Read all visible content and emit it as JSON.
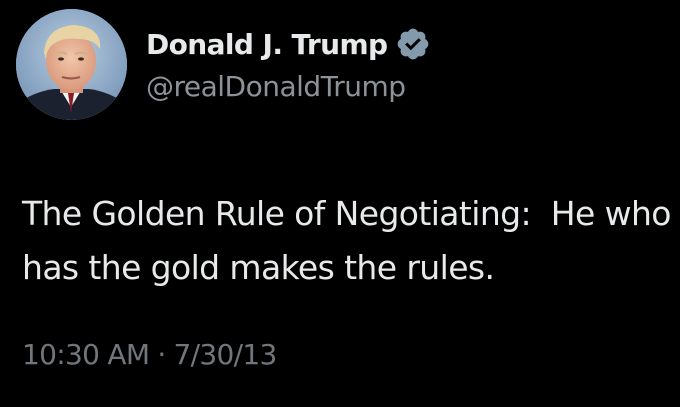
{
  "author": {
    "display_name": "Donald J. Trump",
    "handle": "@realDonaldTrump",
    "verified_icon": "verified-badge-icon",
    "avatar_icon": "profile-photo"
  },
  "tweet": {
    "text": "The Golden Rule of Negotiating:  He who has the gold makes the rules."
  },
  "meta": {
    "time": "10:30 AM",
    "separator": "·",
    "date": "7/30/13"
  },
  "colors": {
    "background": "#000000",
    "primary_text": "#e7e9ea",
    "secondary_text": "#71767b",
    "verified_badge": "#829aab"
  }
}
